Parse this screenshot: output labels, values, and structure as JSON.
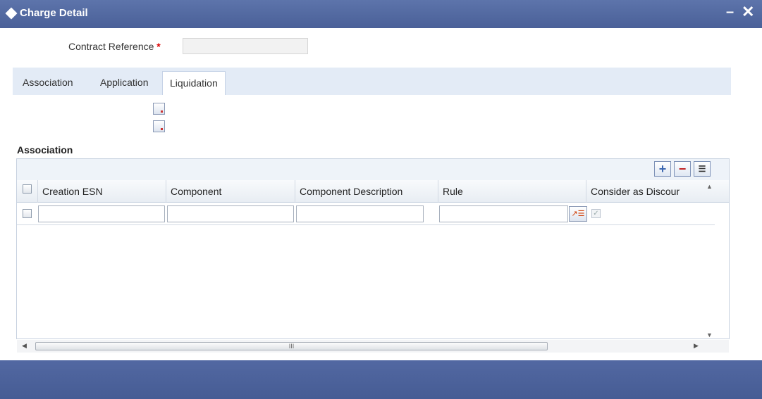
{
  "window": {
    "title": "Charge Detail",
    "minimize_glyph": "–",
    "close_glyph": "✕"
  },
  "form": {
    "contract_reference_label": "Contract Reference",
    "required_marker": "*",
    "contract_reference_value": ""
  },
  "tabs": [
    {
      "label": "Association",
      "active": false
    },
    {
      "label": "Application",
      "active": false
    },
    {
      "label": "Liquidation",
      "active": true
    }
  ],
  "section": {
    "title": "Association"
  },
  "toolbar": {
    "add_glyph": "+",
    "delete_glyph": "−",
    "list_glyph": "☰"
  },
  "grid": {
    "columns": [
      "Creation ESN",
      "Component",
      "Component Description",
      "Rule",
      "Consider as Discour"
    ],
    "rows": [
      {
        "creation_esn": "",
        "component": "",
        "component_description": "",
        "rule": "",
        "consider_as_discount": true
      }
    ],
    "scroll_label": "III"
  },
  "icons": {
    "title": "diamond-icon",
    "lov": "lov-search-icon",
    "add": "plus-icon",
    "delete": "minus-icon",
    "list": "list-icon"
  }
}
